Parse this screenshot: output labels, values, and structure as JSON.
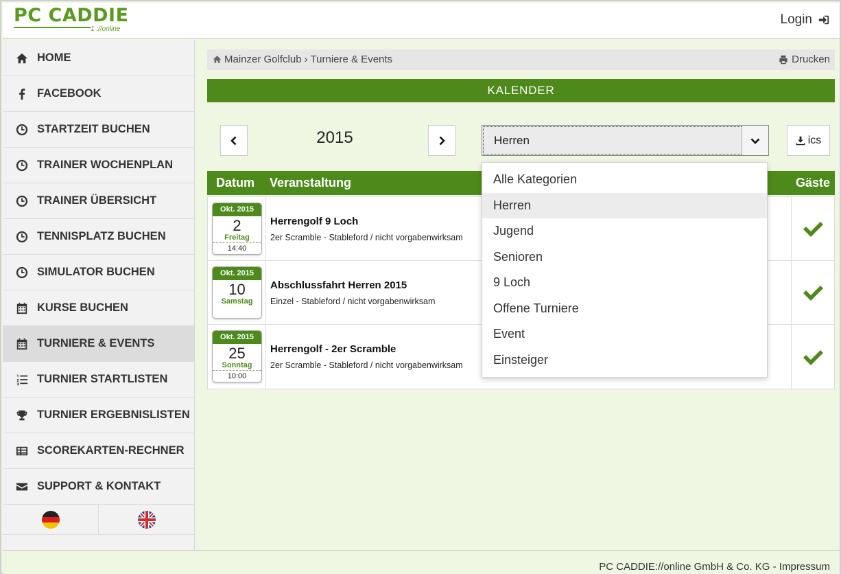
{
  "header": {
    "logo_main": "PC CADDIE",
    "logo_sub": "1 ://online",
    "login_label": "Login"
  },
  "sidebar": {
    "items": [
      {
        "label": "HOME",
        "icon": "home-icon"
      },
      {
        "label": "FACEBOOK",
        "icon": "facebook-icon"
      },
      {
        "label": "STARTZEIT BUCHEN",
        "icon": "clock-icon"
      },
      {
        "label": "TRAINER WOCHENPLAN",
        "icon": "clock-icon"
      },
      {
        "label": "TRAINER ÜBERSICHT",
        "icon": "clock-icon"
      },
      {
        "label": "TENNISPLATZ BUCHEN",
        "icon": "clock-icon"
      },
      {
        "label": "SIMULATOR BUCHEN",
        "icon": "clock-icon"
      },
      {
        "label": "KURSE BUCHEN",
        "icon": "calendar-icon"
      },
      {
        "label": "TURNIERE & EVENTS",
        "icon": "calendar-icon",
        "active": true
      },
      {
        "label": "TURNIER STARTLISTEN",
        "icon": "ordered-list-icon"
      },
      {
        "label": "TURNIER ERGEBNISLISTEN",
        "icon": "trophy-icon"
      },
      {
        "label": "SCOREKARTEN-RECHNER",
        "icon": "table-icon"
      },
      {
        "label": "SUPPORT & KONTAKT",
        "icon": "envelope-icon"
      }
    ],
    "flags": [
      "german-flag-icon",
      "uk-flag-icon"
    ]
  },
  "breadcrumb": {
    "club": "Mainzer Golfclub",
    "separator": "›",
    "section": "Turniere & Events",
    "print_label": "Drucken"
  },
  "calendar": {
    "title": "KALENDER",
    "year": "2015",
    "category_selected": "Herren",
    "ics_label": "ics",
    "category_options": [
      "Alle Kategorien",
      "Herren",
      "Jugend",
      "Senioren",
      "9 Loch",
      "Offene Turniere",
      "Event",
      "Einsteiger"
    ]
  },
  "table": {
    "headers": {
      "datum": "Datum",
      "veranstaltung": "Veranstaltung",
      "gaeste": "Gäste"
    },
    "rows": [
      {
        "month": "Okt. 2015",
        "day": "2",
        "weekday": "Freitag",
        "time": "14:40",
        "title": "Herrengolf 9 Loch",
        "subtitle": "2er Scramble - Stableford / nicht vorgabenwirksam",
        "guests_allowed": true
      },
      {
        "month": "Okt. 2015",
        "day": "10",
        "weekday": "Samstag",
        "time": "",
        "title": "Abschlussfahrt Herren 2015",
        "subtitle": "Einzel - Stableford / nicht vorgabenwirksam",
        "guests_allowed": true
      },
      {
        "month": "Okt. 2015",
        "day": "25",
        "weekday": "Sonntag",
        "time": "10:00",
        "title": "Herrengolf - 2er Scramble",
        "subtitle": "2er Scramble - Stableford / nicht vorgabenwirksam",
        "guests_allowed": true
      }
    ]
  },
  "footer": {
    "text": "PC CADDIE://online GmbH & Co. KG - Impressum"
  },
  "colors": {
    "brand_green": "#4e8a1b",
    "logo_green": "#5a9a1f",
    "page_background": "#eff7e2"
  }
}
